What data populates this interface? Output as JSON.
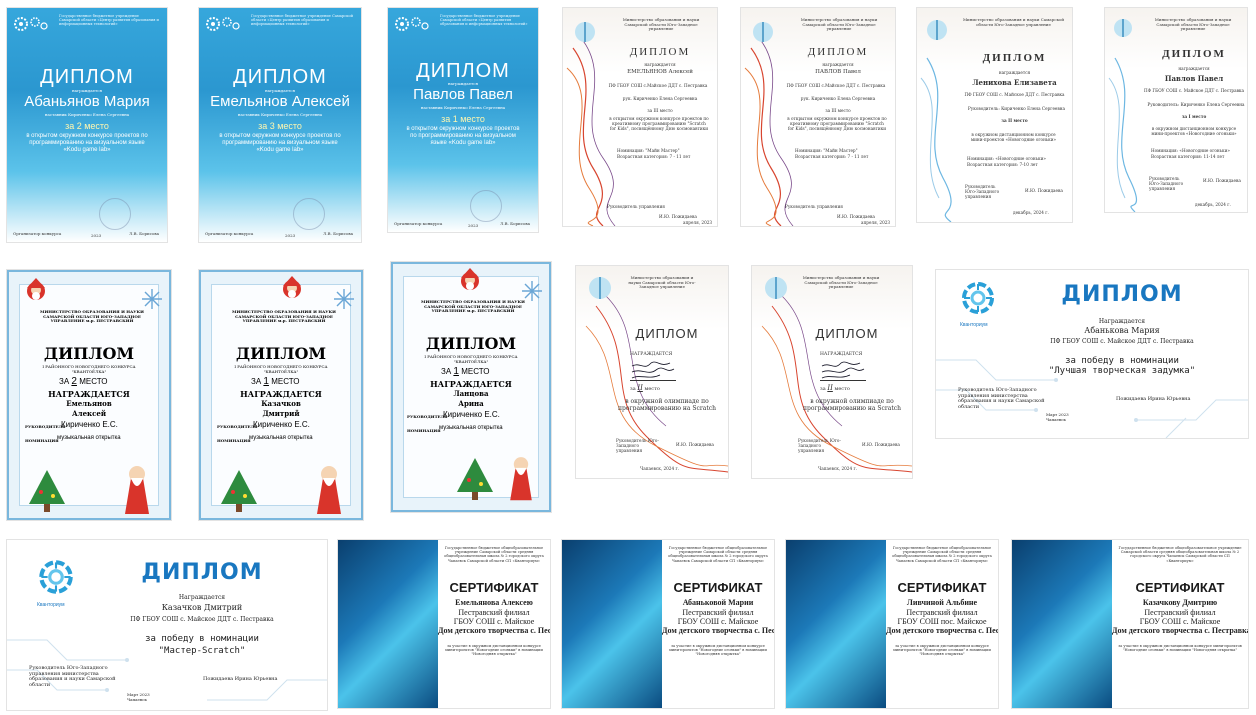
{
  "row1_blue": [
    {
      "header": "Государственное бюджетное учреждение Самарской области «Центр развития образования и информационных технологий»",
      "title": "ДИПЛОМ",
      "awarded": "награждается",
      "name": "Абаньянов Мария",
      "teacher": "наставник Кириченко Елена Сергеевна",
      "place": "за 2 место",
      "desc": "в открытом окружном конкурсе проектов по программированию на визуальном языке «Kodu game lab»",
      "foot_left": "Организатор конкурса",
      "foot_year": "2023",
      "foot_right": "Л.В. Борисова"
    },
    {
      "header": "Государственное бюджетное учреждение Самарской области «Центр развития образования и информационных технологий»",
      "title": "ДИПЛОМ",
      "awarded": "награждается",
      "name": "Емельянов Алексей",
      "teacher": "наставник Кириченко Елена Сергеевна",
      "place": "за 3 место",
      "desc": "в открытом окружном конкурсе проектов по программированию на визуальном языке «Kodu game lab»",
      "foot_left": "Организатор конкурса",
      "foot_year": "2023",
      "foot_right": "Л.В. Борисова"
    },
    {
      "header": "Государственное бюджетное учреждение Самарской области «Центр развития образования и информационных технологий»",
      "title": "ДИПЛОМ",
      "awarded": "награждается",
      "name": "Павлов Павел",
      "teacher": "наставник Кириченко Елена Сергеевна",
      "place": "за 1 место",
      "desc": "в открытом окружном конкурсе проектов по программированию на визуальном языке «Kodu game lab»",
      "foot_left": "Организатор конкурса",
      "foot_year": "2023",
      "foot_right": "Л.В. Борисова"
    }
  ],
  "row1_ribbon": [
    {
      "ministry": "Министерство образования и науки Самарской области Юго-Западное управление",
      "title": "ДИПЛОМ",
      "awarded": "награждается",
      "name": "ЕМЕЛЬЯНОВ Алексей",
      "org": "ПФ ГБОУ СОШ с.Майское ДДТ с. Пестравка",
      "teacher": "рук. Кириченко Елена Сергеевна",
      "place": "за III место",
      "desc": "в открытом окружном конкурсе проектов по креативному программированию \"Scratch for Kids\", посвящённому Дню космонавтики",
      "nom": "Номинация: \"Майн Мастер\"",
      "age": "Возрастная категория: 7 - 11 лет",
      "sign": "Руководитель управления",
      "signer": "И.Ю. Пожидаева",
      "date": "апреля, 2023"
    },
    {
      "ministry": "Министерство образования и науки Самарской области Юго-Западное управление",
      "title": "ДИПЛОМ",
      "awarded": "награждается",
      "name": "ПАВЛОВ Павел",
      "org": "ПФ ГБОУ СОШ с.Майское ДДТ с. Пестравка",
      "teacher": "рук. Кириченко Елена Сергеевна",
      "place": "за III место",
      "desc": "в открытом окружном конкурсе проектов по креативному программированию \"Scratch for Kids\", посвящённому Дню космонавтики",
      "nom": "Номинация: \"Майн Мастер\"",
      "age": "Возрастная категория: 7 - 11 лет",
      "sign": "Руководитель управления",
      "signer": "И.Ю. Пожидаева",
      "date": "апреля, 2023"
    },
    {
      "ministry": "Министерство образования и науки Самарской области Юго-Западное управление",
      "title": "ДИПЛОМ",
      "awarded": "награждается",
      "name": "Ленихова Елизавета",
      "org": "ПФ ГБОУ СОШ с. Майское ДДТ с. Пестравка",
      "teacher": "Руководитель: Кириченко Елена Сергеевна",
      "place": "за II место",
      "desc": "в окружном дистанционном конкурсе мини-проектов «Новогодние огоньки»",
      "nom": "Номинация: «Новогодние огоньки»",
      "age": "Возрастная категория: 7-10 лет",
      "sign": "Руководитель Юго-Западного управления",
      "signer": "И.Ю. Пожидаева",
      "date": "декабрь, 2024 г."
    },
    {
      "ministry": "Министерство образования и науки Самарской области Юго-Западное управление",
      "title": "ДИПЛОМ",
      "awarded": "награждается",
      "name": "Павлов Павел",
      "org": "ПФ ГБОУ СОШ с. Майское ДДТ с. Пестравка",
      "teacher": "Руководитель: Кириченко Елена Сергеевна",
      "place": "за I место",
      "desc": "в окружном дистанционном конкурсе мини-проектов «Новогодние огоньки»",
      "nom": "Номинация: «Новогодние огоньки»",
      "age": "Возрастная категория: 11-14 лет",
      "sign": "Руководитель Юго-Западного управления",
      "signer": "И.Ю. Пожидаева",
      "date": "декабрь, 2024 г."
    }
  ],
  "row2_xmas": [
    {
      "ministry": "МИНИСТЕРСТВО ОБРАЗОВАНИЯ И НАУКИ САМАРСКОЙ ОБЛАСТИ ЮГО-ЗАПАДНОЕ УПРАВЛЕНИЕ м.р. ПЕСТРАВСКИЙ",
      "title": "ДИПЛОМ",
      "contest": "I РАЙОННОГО НОВОГОДНЕГО КОНКУРСА \"КВАНТОЁЛКА\"",
      "za": "ЗА",
      "num": "2",
      "mesto": "МЕСТО",
      "awarded": "НАГРАЖДАЕТСЯ",
      "surname": "Емельянов",
      "first": "Алексей",
      "ruk_label": "РУКОВОДИТЕЛЬ",
      "ruk": "Кириченко Е.С.",
      "nom_label": "НОМИНАЦИЯ",
      "nom": "музыкальная открытка"
    },
    {
      "ministry": "МИНИСТЕРСТВО ОБРАЗОВАНИЯ И НАУКИ САМАРСКОЙ ОБЛАСТИ ЮГО-ЗАПАДНОЕ УПРАВЛЕНИЕ м.р. ПЕСТРАВСКИЙ",
      "title": "ДИПЛОМ",
      "contest": "I РАЙОННОГО НОВОГОДНЕГО КОНКУРСА \"КВАНТОЁЛКА\"",
      "za": "ЗА",
      "num": "1",
      "mesto": "МЕСТО",
      "awarded": "НАГРАЖДАЕТСЯ",
      "surname": "Казачков",
      "first": "Дмитрий",
      "ruk_label": "РУКОВОДИТЕЛЬ",
      "ruk": "Кириченко Е.С.",
      "nom_label": "НОМИНАЦИЯ",
      "nom": "музыкальная открытка"
    },
    {
      "ministry": "МИНИСТЕРСТВО ОБРАЗОВАНИЯ И НАУКИ САМАРСКОЙ ОБЛАСТИ ЮГО-ЗАПАДНОЕ УПРАВЛЕНИЕ м.р. ПЕСТРАВСКИЙ",
      "title": "ДИПЛОМ",
      "contest": "I РАЙОННОГО НОВОГОДНЕГО КОНКУРСА \"КВАНТОЁЛКА\"",
      "za": "ЗА",
      "num": "1",
      "mesto": "МЕСТО",
      "awarded": "НАГРАЖДАЕТСЯ",
      "surname": "Ланцова",
      "first": "Арина",
      "ruk_label": "РУКОВОДИТЕЛЬ",
      "ruk": "Кириченко Е.С.",
      "nom_label": "НОМИНАЦИЯ",
      "nom": "музыкальная открытка"
    }
  ],
  "row2_olymp": [
    {
      "ministry": "Министерство образования и науки Самарской области Юго-Западное управление",
      "title": "ДИПЛОМ",
      "awarded": "НАГРАЖДАЕТСЯ",
      "za": "за",
      "num": "II",
      "mesto": "место",
      "desc": "в окружной олимпиаде по программированию на Scratch",
      "sign": "Руководитель Юго-Западного управления",
      "signer": "И.Ю. Пожидаева",
      "date": "Чапаевск, 2024 г."
    },
    {
      "ministry": "Министерство образования и науки Самарской области Юго-Западное управление",
      "title": "ДИПЛОМ",
      "awarded": "НАГРАЖДАЕТСЯ",
      "za": "за",
      "num": "II",
      "mesto": "место",
      "desc": "в окружной олимпиаде по программированию на Scratch",
      "sign": "Руководитель Юго-Западного управления",
      "signer": "И.Ю. Пожидаева",
      "date": "Чапаевск, 2024 г."
    }
  ],
  "kvant": [
    {
      "logo_text": "Кванториум",
      "title": "ДИПЛОМ",
      "awarded": "Награждается",
      "name": "Абанькова Мария",
      "org": "ПФ ГБОУ СОШ с. Майское ДДТ с. Пестравка",
      "for": "за победу в номинации",
      "nom": "\"Лучшая творческая задумка\"",
      "sign": "Руководитель Юго-Западного управления министерства образования и науки Самарской области",
      "signer": "Пожидаева Ирина Юрьевна",
      "date": "Март 2023 Чапаевск"
    },
    {
      "logo_text": "Кванториум",
      "title": "ДИПЛОМ",
      "awarded": "Награждается",
      "name": "Казачков Дмитрий",
      "org": "ПФ ГБОУ СОШ с. Майское ДДТ с. Пестравка",
      "for": "за победу в номинации",
      "nom": "\"Мастер-Scratch\"",
      "sign": "Руководитель Юго-Западного управления министерства образования и науки Самарской области",
      "signer": "Пожидаева Ирина Юрьевна",
      "date": "Март 2023 Чапаевск"
    }
  ],
  "certs": [
    {
      "hdr": "Государственное бюджетное общеобразовательное учреждение Самарской области средняя общеобразовательная школа № 2 городского округа Чапаевск Самарской области СП «Кванториум»",
      "title": "СЕРТИФИКАТ",
      "name": "Емельянова Алексею",
      "l1": "Пестравский филиал",
      "l2": "ГБОУ СОШ с. Майское",
      "l3": "Дом детского творчества с. Пестравка",
      "foot": "за участие в окружном дистанционном конкурсе мини-проектов \"Новогодние огоньки\" в номинации \"Новогодняя открытка\""
    },
    {
      "hdr": "Государственное бюджетное общеобразовательное учреждение Самарской области средняя общеобразовательная школа № 2 городского округа Чапаевск Самарской области СП «Кванториум»",
      "title": "СЕРТИФИКАТ",
      "name": "Абаньковой Марии",
      "l1": "Пестравский филиал",
      "l2": "ГБОУ СОШ с. Майское",
      "l3": "Дом детского творчества с. Пестравка",
      "foot": "за участие в окружном дистанционном конкурсе мини-проектов \"Новогодние огоньки\" в номинации \"Новогодняя открытка\""
    },
    {
      "hdr": "Государственное бюджетное общеобразовательное учреждение Самарской области средняя общеобразовательная школа № 2 городского округа Чапаевск Самарской области СП «Кванториум»",
      "title": "СЕРТИФИКАТ",
      "name": "Ливчиной Альбине",
      "l1": "Пестравский филиал",
      "l2": "ГБОУ СОШ пос. Майское",
      "l3": "Дом детского творчества с. Пестравка",
      "foot": "за участие в окружном дистанционном конкурсе мини-проектов \"Новогодние огоньки\" в номинации \"Новогодняя открытка\""
    },
    {
      "hdr": "Государственное бюджетное общеобразовательное учреждение Самарской области средняя общеобразовательная школа № 2 городского округа Чапаевск Самарской области СП «Кванториум»",
      "title": "СЕРТИФИКАТ",
      "name": "Казачкову Дмитрию",
      "l1": "Пестравский филиал",
      "l2": "ГБОУ СОШ с. Майское",
      "l3": "Дом детского творчества с. Пестравка",
      "foot": "за участие в окружном дистанционном конкурсе мини-проектов \"Новогодние огоньки\" в номинации \"Новогодняя открытка\""
    }
  ],
  "colors": {
    "kodu_blue": "#2b97d0",
    "kvant_blue": "#1977c0",
    "ribbon_red": "#d8452f",
    "xmas_border": "#7ab7dd"
  }
}
